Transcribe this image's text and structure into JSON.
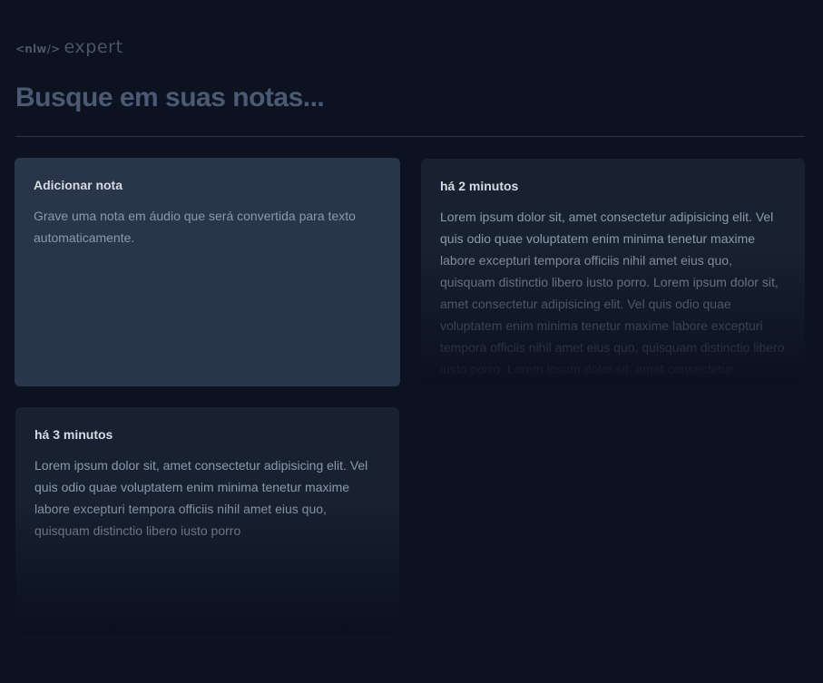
{
  "logo": {
    "prefix": "<nlw/>",
    "name": "expert"
  },
  "search": {
    "placeholder": "Busque em suas notas..."
  },
  "add_card": {
    "title": "Adicionar nota",
    "description": "Grave uma nota em áudio que será convertida para texto automaticamente."
  },
  "notes": [
    {
      "time": "há 2 minutos",
      "content": "Lorem ipsum dolor sit, amet consectetur adipisicing elit. Vel quis odio quae voluptatem enim minima tenetur maxime labore excepturi tempora officiis nihil amet eius quo, quisquam distinctio libero iusto porro. Lorem ipsum dolor sit, amet consectetur adipisicing elit. Vel quis odio quae voluptatem enim minima tenetur maxime labore excepturi tempora officiis nihil amet eius quo, quisquam distinctio libero iusto porro. Lorem ipsum dolor sit, amet consectetur adipisicing elit."
    },
    {
      "time": "há 3 minutos",
      "content": "Lorem ipsum dolor sit, amet consectetur adipisicing elit. Vel quis odio quae voluptatem enim minima tenetur maxime labore excepturi tempora officiis nihil amet eius quo, quisquam distinctio libero iusto porro"
    }
  ],
  "colors": {
    "background": "#0c1220",
    "add_card": "#293548",
    "note_card": "#182130",
    "placeholder": "#4b5a72"
  }
}
